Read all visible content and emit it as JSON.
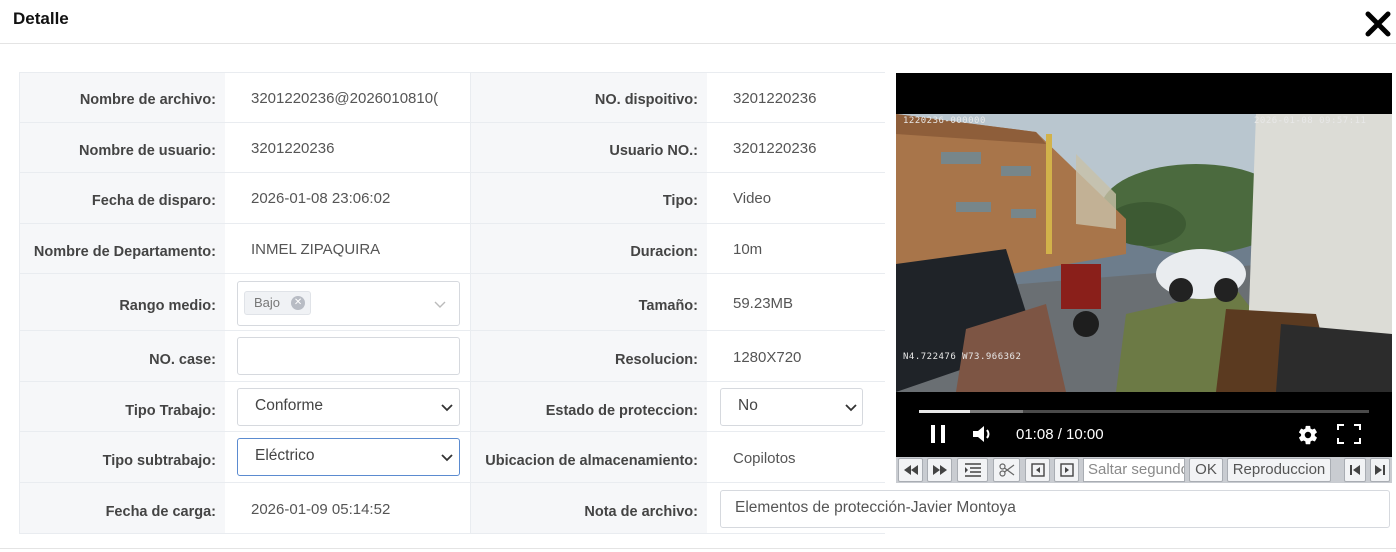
{
  "header": {
    "title": "Detalle"
  },
  "rows": [
    {
      "l1": "Nombre de archivo:",
      "v1": "3201220236@2026010810(",
      "l2": "NO. dispoitivo:",
      "v2": "3201220236"
    },
    {
      "l1": "Nombre de usuario:",
      "v1": "3201220236",
      "l2": "Usuario NO.:",
      "v2": "3201220236"
    },
    {
      "l1": "Fecha de disparo:",
      "v1": "2026-01-08 23:06:02",
      "l2": "Tipo:",
      "v2": "Video"
    },
    {
      "l1": "Nombre de Departamento:",
      "v1": "INMEL ZIPAQUIRA",
      "l2": "Duracion:",
      "v2": "10m"
    },
    {
      "l1": "Rango medio:",
      "v1": "",
      "l2": "Tamaño:",
      "v2": "59.23MB"
    },
    {
      "l1": "NO. case:",
      "v1": "",
      "l2": "Resolucion:",
      "v2": "1280X720"
    },
    {
      "l1": "Tipo Trabajo:",
      "v1": "Conforme",
      "l2": "Estado de proteccion:",
      "v2": "No"
    },
    {
      "l1": "Tipo subtrabajo:",
      "v1": "Eléctrico",
      "l2": "Ubicacion de almacenamiento:",
      "v2": "Copilotos"
    },
    {
      "l1": "Fecha de carga:",
      "v1": "2026-01-09 05:14:52",
      "l2": "Nota de archivo:",
      "v2": "Elementos de protección-Javier Montoya"
    }
  ],
  "rango_medio": {
    "tag": "Bajo"
  },
  "no_case": {
    "value": ""
  },
  "video": {
    "osd_device": "1220236-000000",
    "osd_datetime": "2026-01-08  09:57:11",
    "osd_gps": "N4.722476  W73.966362",
    "time": "01:08 / 10:00",
    "progress_fraction": 0.113,
    "buffered_fraction": 0.23,
    "icons": {
      "play_state": "pause-icon",
      "volume": "volume-icon",
      "settings": "gear-icon",
      "fullscreen": "fullscreen-icon"
    }
  },
  "toolbar": {
    "jump_placeholder": "Saltar segundos",
    "ok_label": "OK",
    "playback_label": "Reproduccion"
  },
  "colors": {
    "focus_border": "#5b8bd0",
    "label_bg": "#f6f7f9"
  }
}
